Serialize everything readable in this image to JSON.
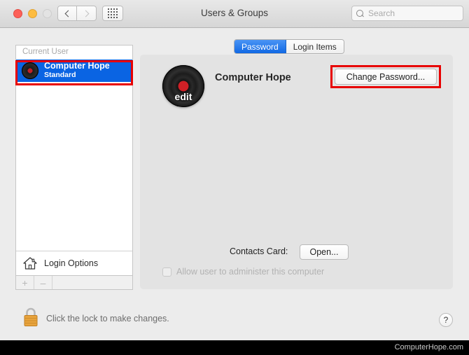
{
  "window": {
    "title": "Users & Groups"
  },
  "titlebar": {
    "traffic": {
      "close_name": "close",
      "minimize_name": "minimize",
      "zoom_name": "zoom"
    },
    "back_label": "Back",
    "forward_label": "Forward",
    "showall_label": "Show All"
  },
  "search": {
    "placeholder": "Search",
    "value": "",
    "icon": "search-icon"
  },
  "sidebar": {
    "section_header": "Current User",
    "users": [
      {
        "name": "Computer Hope",
        "kind": "Standard",
        "selected": true,
        "avatar_icon": "vinyl-record-avatar"
      }
    ],
    "login_options_label": "Login Options",
    "login_options_icon": "home-icon",
    "add_label": "+",
    "remove_label": "–"
  },
  "tabs": [
    {
      "label": "Password",
      "active": true
    },
    {
      "label": "Login Items",
      "active": false
    }
  ],
  "main": {
    "avatar_icon": "vinyl-record-avatar",
    "avatar_edit_label": "edit",
    "full_name": "Computer Hope",
    "change_password_label": "Change Password...",
    "contacts_card_label": "Contacts Card:",
    "open_label": "Open...",
    "allow_admin_label": "Allow user to administer this computer",
    "allow_admin_checked": false
  },
  "footer": {
    "lock_icon": "lock-closed-icon",
    "lock_text": "Click the lock to make changes.",
    "help_label": "?"
  },
  "watermark": {
    "text": "ComputerHope.com"
  },
  "colors": {
    "accent_blue": "#0a64e3",
    "highlight_red": "#e80000",
    "lock_gold": "#e8a33d"
  }
}
